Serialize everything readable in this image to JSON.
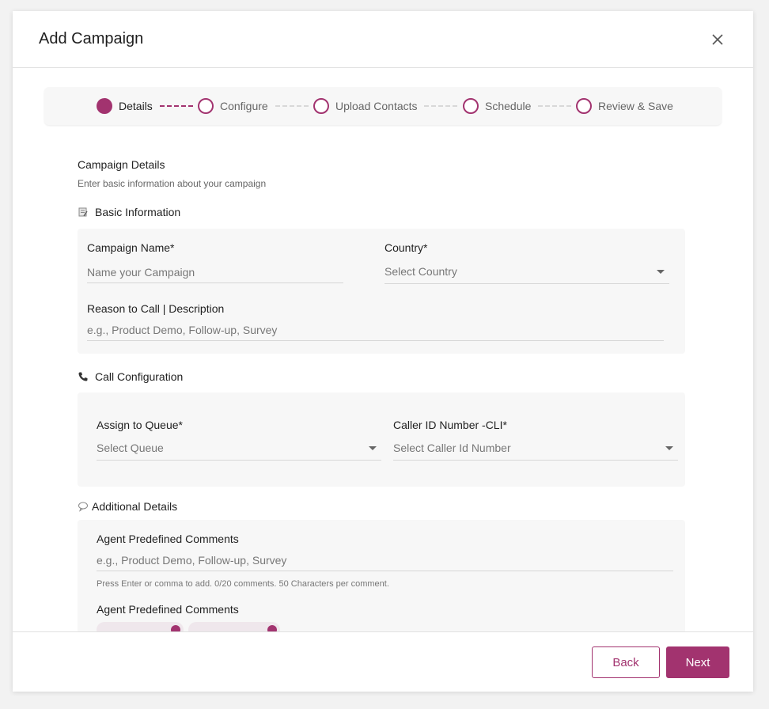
{
  "modal": {
    "title": "Add Campaign"
  },
  "stepper": {
    "steps": [
      {
        "label": "Details",
        "active": true
      },
      {
        "label": "Configure",
        "active": false
      },
      {
        "label": "Upload Contacts",
        "active": false
      },
      {
        "label": "Schedule",
        "active": false
      },
      {
        "label": "Review & Save",
        "active": false
      }
    ]
  },
  "details": {
    "title": "Campaign Details",
    "subtitle": "Enter basic information about your campaign"
  },
  "basic_info": {
    "heading": "Basic Information",
    "campaign_name": {
      "label": "Campaign Name*",
      "placeholder": "Name your Campaign"
    },
    "country": {
      "label": "Country*",
      "placeholder": "Select Country"
    },
    "reason": {
      "label": "Reason to Call | Description",
      "placeholder": "e.g., Product Demo, Follow-up, Survey"
    }
  },
  "call_config": {
    "heading": "Call Configuration",
    "queue": {
      "label": "Assign to Queue*",
      "placeholder": "Select Queue"
    },
    "caller_id": {
      "label": "Caller ID Number -CLI*",
      "placeholder": "Select Caller Id Number"
    }
  },
  "additional": {
    "heading": "Additional Details",
    "comments": {
      "label": "Agent Predefined Comments",
      "placeholder": "e.g., Product Demo, Follow-up, Survey",
      "helper": "Press Enter or comma to add. 0/20 comments. 50 Characters per comment."
    },
    "comments_list_label": "Agent Predefined Comments"
  },
  "footer": {
    "back_label": "Back",
    "next_label": "Next"
  },
  "colors": {
    "accent": "#a2336f",
    "panel": "#f7f7f7",
    "divider": "#e0e0e0"
  }
}
